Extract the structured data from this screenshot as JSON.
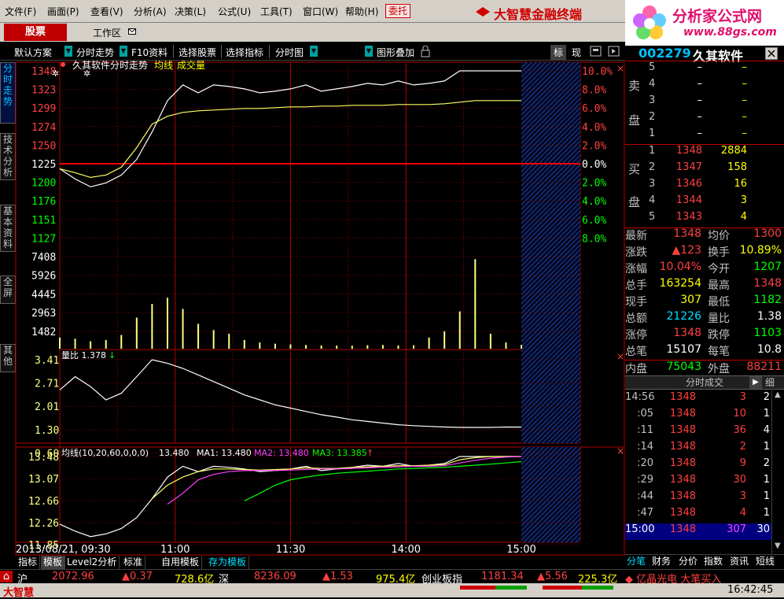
{
  "menubar": {
    "items": [
      "文件(F)",
      "画面(P)",
      "查看(V)",
      "分析(A)",
      "决策(L)",
      "公式(U)",
      "工具(T)",
      "窗口(W)",
      "帮助(H)"
    ],
    "order_button": "委托",
    "brand": "大智慧金融终端",
    "site_name": "分析家公式网",
    "site_url": "www.88gs.com"
  },
  "tabs": {
    "stock": "股票",
    "workspace": "工作区"
  },
  "toolbar": {
    "items": [
      "默认方案",
      "分时走势",
      "F10资料",
      "选择股票",
      "选择指标",
      "分时图",
      "图形叠加"
    ],
    "right_items": [
      "标",
      "现"
    ]
  },
  "side_tabs": [
    "分时走势",
    "技术分析",
    "基本资料",
    "全屏",
    "其他"
  ],
  "chart_header": {
    "title": "久其软件分时走势",
    "avg_label": "均线",
    "vol_label": "成交量",
    "volratio_label": "量比 1.378",
    "ma_label_prefix": "均线(10,20,60,0,0,0)",
    "ma_price": "13.480",
    "ma1": "MA1: 13.480",
    "ma2": "MA2: 13.480",
    "ma3": "MA3: 13.385"
  },
  "price_axis": {
    "left": [
      "1348",
      "1323",
      "1299",
      "1274",
      "1250",
      "1225",
      "1200",
      "1176",
      "1151",
      "1127"
    ],
    "right": [
      "10.0%",
      "8.0%",
      "6.0%",
      "4.0%",
      "2.0%",
      "0.0%",
      "2.0%",
      "4.0%",
      "6.0%",
      "8.0%"
    ],
    "prev_close": 12.25,
    "top": 13.48,
    "bottom": 11.27
  },
  "volume_axis": {
    "labels": [
      "7408",
      "5926",
      "4445",
      "2963",
      "1482"
    ],
    "max": 7408
  },
  "volratio_axis": {
    "labels": [
      "3.41",
      "2.71",
      "2.01",
      "1.30",
      "0.60"
    ],
    "max": 3.41,
    "min": 0.6
  },
  "ma_axis": {
    "labels": [
      "13.48",
      "13.07",
      "12.66",
      "12.26",
      "11.85"
    ],
    "max": 13.48,
    "min": 11.85
  },
  "time_axis": {
    "labels": [
      "2013/08/21, 09:30",
      "11:00",
      "11:30",
      "14:00",
      "15:00"
    ]
  },
  "bottom_tabs": [
    "指标",
    "模板",
    "Level2分析",
    "标准",
    "自用模板",
    "存为模板"
  ],
  "ticker": {
    "sh_label": "沪",
    "sh_index": "2072.96",
    "sh_change": "▲0.37",
    "sh_amount": "728.6亿",
    "sz_label": "深",
    "sz_index": "8236.09",
    "sz_change": "▲1.53",
    "sz_amount": "975.4亿",
    "cy_label": "创业板指",
    "cy_index": "1181.34",
    "cy_change": "▲5.56",
    "cy_amount": "225.3亿",
    "news": "◆ 亿晶光电 大笔买入"
  },
  "status": {
    "logo": "大智慧",
    "time": "16:42:45"
  },
  "quote": {
    "code": "002279",
    "name": "久其软件",
    "sell_label": "卖盘",
    "buy_label": "买盘",
    "asks": [
      {
        "idx": "5",
        "price": "–",
        "vol": "–"
      },
      {
        "idx": "4",
        "price": "–",
        "vol": "–"
      },
      {
        "idx": "3",
        "price": "–",
        "vol": "–"
      },
      {
        "idx": "2",
        "price": "–",
        "vol": "–"
      },
      {
        "idx": "1",
        "price": "–",
        "vol": "–"
      }
    ],
    "bids": [
      {
        "idx": "1",
        "price": "1348",
        "vol": "2884"
      },
      {
        "idx": "2",
        "price": "1347",
        "vol": "158"
      },
      {
        "idx": "3",
        "price": "1346",
        "vol": "16"
      },
      {
        "idx": "4",
        "price": "1344",
        "vol": "3"
      },
      {
        "idx": "5",
        "price": "1343",
        "vol": "4"
      }
    ],
    "stats": [
      {
        "l": "最新",
        "v": "1348",
        "l2": "均价",
        "v2": "1300",
        "c": "red",
        "c2": "red"
      },
      {
        "l": "涨跌",
        "v": "▲123",
        "l2": "换手",
        "v2": "10.89%",
        "c": "red",
        "c2": "yel"
      },
      {
        "l": "涨幅",
        "v": "10.04%",
        "l2": "今开",
        "v2": "1207",
        "c": "red",
        "c2": "grn"
      },
      {
        "l": "总手",
        "v": "163254",
        "l2": "最高",
        "v2": "1348",
        "c": "yel",
        "c2": "red"
      },
      {
        "l": "现手",
        "v": "307",
        "l2": "最低",
        "v2": "1182",
        "c": "yel",
        "c2": "grn"
      },
      {
        "l": "总额",
        "v": "21226",
        "l2": "量比",
        "v2": "1.38",
        "c": "cyn",
        "c2": "wht"
      },
      {
        "l": "涨停",
        "v": "1348",
        "l2": "跌停",
        "v2": "1103",
        "c": "red",
        "c2": "grn"
      },
      {
        "l": "总笔",
        "v": "15107",
        "l2": "每笔",
        "v2": "10.8",
        "c": "wht",
        "c2": "wht"
      },
      {
        "l": "内盘",
        "v": "75043",
        "l2": "外盘",
        "v2": "88211",
        "c": "grn",
        "c2": "red"
      }
    ],
    "ticks_header": "分时成交",
    "ticks_detail": "细",
    "ticks": [
      {
        "t": "14:56",
        "p": "1348",
        "v": "3",
        "n": "2",
        "vc": "red"
      },
      {
        "t": ":05",
        "p": "1348",
        "v": "10",
        "n": "1",
        "vc": "red"
      },
      {
        "t": ":11",
        "p": "1348",
        "v": "36",
        "n": "4",
        "vc": "red"
      },
      {
        "t": ":14",
        "p": "1348",
        "v": "2",
        "n": "1",
        "vc": "red"
      },
      {
        "t": ":20",
        "p": "1348",
        "v": "9",
        "n": "2",
        "vc": "red"
      },
      {
        "t": ":29",
        "p": "1348",
        "v": "30",
        "n": "1",
        "vc": "red"
      },
      {
        "t": ":44",
        "p": "1348",
        "v": "3",
        "n": "1",
        "vc": "red"
      },
      {
        "t": ":47",
        "p": "1348",
        "v": "4",
        "n": "1",
        "vc": "red"
      },
      {
        "t": "15:00",
        "p": "1348",
        "v": "307",
        "n": "30",
        "vc": "mag"
      }
    ],
    "tabs": [
      "分笔",
      "财务",
      "分价",
      "指数",
      "资讯",
      "短线"
    ]
  },
  "chart_data": {
    "type": "line",
    "title": "久其软件分时走势",
    "x_labels": [
      "09:30",
      "11:00",
      "11:30",
      "14:00",
      "15:00"
    ],
    "price_series": [
      {
        "name": "价格",
        "values": [
          12.23,
          12.1,
          12.0,
          12.05,
          12.15,
          12.35,
          12.7,
          13.1,
          13.3,
          13.2,
          13.3,
          13.28,
          13.25,
          13.2,
          13.22,
          13.25,
          13.3,
          13.22,
          13.25,
          13.28,
          13.32,
          13.3,
          13.35,
          13.3,
          13.32,
          13.35,
          13.48,
          13.48,
          13.48,
          13.48,
          13.48
        ]
      },
      {
        "name": "均线",
        "values": [
          12.23,
          12.18,
          12.12,
          12.15,
          12.25,
          12.5,
          12.8,
          12.9,
          12.95,
          12.97,
          12.98,
          12.99,
          13.0,
          13.0,
          13.01,
          13.02,
          13.02,
          13.03,
          13.03,
          13.04,
          13.04,
          13.04,
          13.05,
          13.05,
          13.05,
          13.06,
          13.08,
          13.1,
          13.1,
          13.1,
          13.1
        ]
      }
    ],
    "volume_values": [
      900,
      800,
      600,
      700,
      1100,
      2500,
      3600,
      4100,
      3200,
      2000,
      1500,
      1200,
      700,
      500,
      400,
      350,
      300,
      260,
      250,
      240,
      280,
      300,
      260,
      280,
      900,
      1400,
      3000,
      7200,
      1200,
      500,
      300
    ],
    "volratio_values": [
      2.5,
      2.9,
      2.6,
      2.2,
      2.4,
      2.9,
      3.41,
      3.3,
      3.15,
      2.95,
      2.75,
      2.55,
      2.35,
      2.2,
      2.05,
      1.95,
      1.85,
      1.75,
      1.68,
      1.6,
      1.55,
      1.5,
      1.45,
      1.42,
      1.4,
      1.38,
      1.37,
      1.37,
      1.37,
      1.38,
      1.378
    ],
    "ma_series": [
      {
        "name": "MA1",
        "values": [
          null,
          null,
          null,
          null,
          null,
          null,
          12.7,
          12.95,
          13.1,
          13.2,
          13.25,
          13.25,
          13.24,
          13.23,
          13.24,
          13.25,
          13.27,
          13.26,
          13.26,
          13.28,
          13.29,
          13.3,
          13.31,
          13.31,
          13.32,
          13.33,
          13.42,
          13.46,
          13.48,
          13.48,
          13.48
        ]
      },
      {
        "name": "MA2",
        "values": [
          null,
          null,
          null,
          null,
          null,
          null,
          null,
          12.6,
          12.8,
          13.05,
          13.15,
          13.2,
          13.22,
          13.22,
          13.22,
          13.23,
          13.24,
          13.25,
          13.25,
          13.26,
          13.27,
          13.28,
          13.29,
          13.3,
          13.3,
          13.31,
          13.36,
          13.41,
          13.45,
          13.47,
          13.48
        ]
      },
      {
        "name": "MA3",
        "values": [
          null,
          null,
          null,
          null,
          null,
          null,
          null,
          null,
          null,
          null,
          null,
          null,
          12.66,
          12.8,
          12.95,
          13.05,
          13.1,
          13.14,
          13.17,
          13.19,
          13.21,
          13.23,
          13.25,
          13.26,
          13.27,
          13.28,
          13.3,
          13.32,
          13.34,
          13.36,
          13.385
        ]
      }
    ],
    "ylim": [
      11.27,
      13.48
    ]
  }
}
